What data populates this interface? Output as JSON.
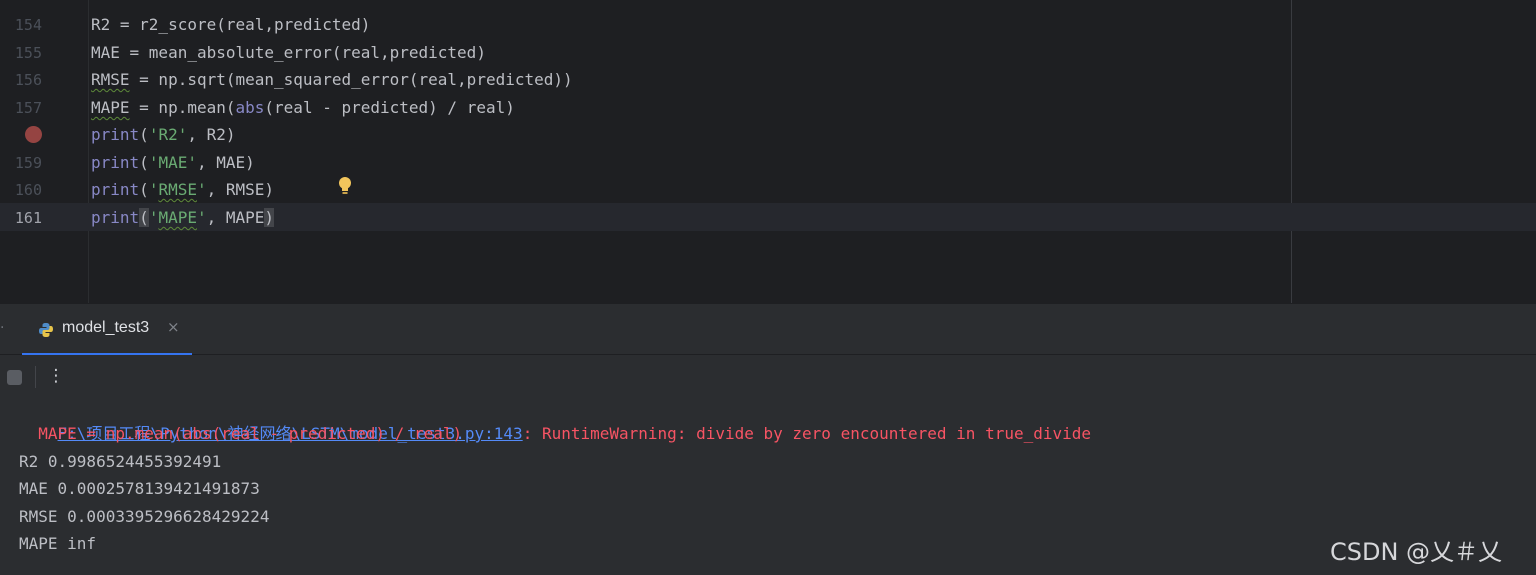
{
  "editor": {
    "lines": [
      {
        "num": "154",
        "code": "R2 = r2_score(real,predicted)"
      },
      {
        "num": "155",
        "code": "MAE = mean_absolute_error(real,predicted)"
      },
      {
        "num": "156",
        "pre": "RMSE",
        "post": " = np.sqrt(mean_squared_error(real,predicted))"
      },
      {
        "num": "157",
        "pre": "MAPE",
        "mid": " = np.mean(",
        "kw": "abs",
        "post": "(real - predicted) / real)"
      },
      {
        "num": "",
        "kw": "print",
        "open": "(",
        "str": "'R2'",
        "post": ", R2)"
      },
      {
        "num": "159",
        "kw": "print",
        "open": "(",
        "str": "'MAE'",
        "post": ", MAE)"
      },
      {
        "num": "160",
        "kw": "print",
        "open": "(",
        "q1": "'",
        "strw": "RMSE",
        "q2": "'",
        "post": ", RMSE)"
      },
      {
        "num": "161",
        "kw": "print",
        "open": "(",
        "q1": "'",
        "strw": "MAPE",
        "q2": "'",
        "post": ", MAPE",
        "close": ")"
      }
    ]
  },
  "run_panel": {
    "tab_label": "model_test3",
    "close_glyph": "×",
    "more_glyph": "⋮",
    "left_handle_glyph": "·"
  },
  "console": {
    "warning_link": "F:\\项目工程\\Python\\神经网络\\LSTM\\model_test3.py:143",
    "warning_text": ": RuntimeWarning: divide by zero encountered in true_divide",
    "warning_source": "  MAPE = np.mean(abs(real - predicted) / real)",
    "outputs": [
      "R2 0.9986524455392491",
      "MAE 0.0002578139421491873",
      "RMSE 0.0003395296628429224",
      "MAPE inf"
    ]
  },
  "watermark": "CSDN @乂＃乂",
  "colors": {
    "background": "#1e1f22",
    "keyword": "#8888c6",
    "string": "#6aab73",
    "error": "#f75464",
    "link": "#548af7",
    "accent": "#3574f0",
    "breakpoint": "#c75450"
  }
}
